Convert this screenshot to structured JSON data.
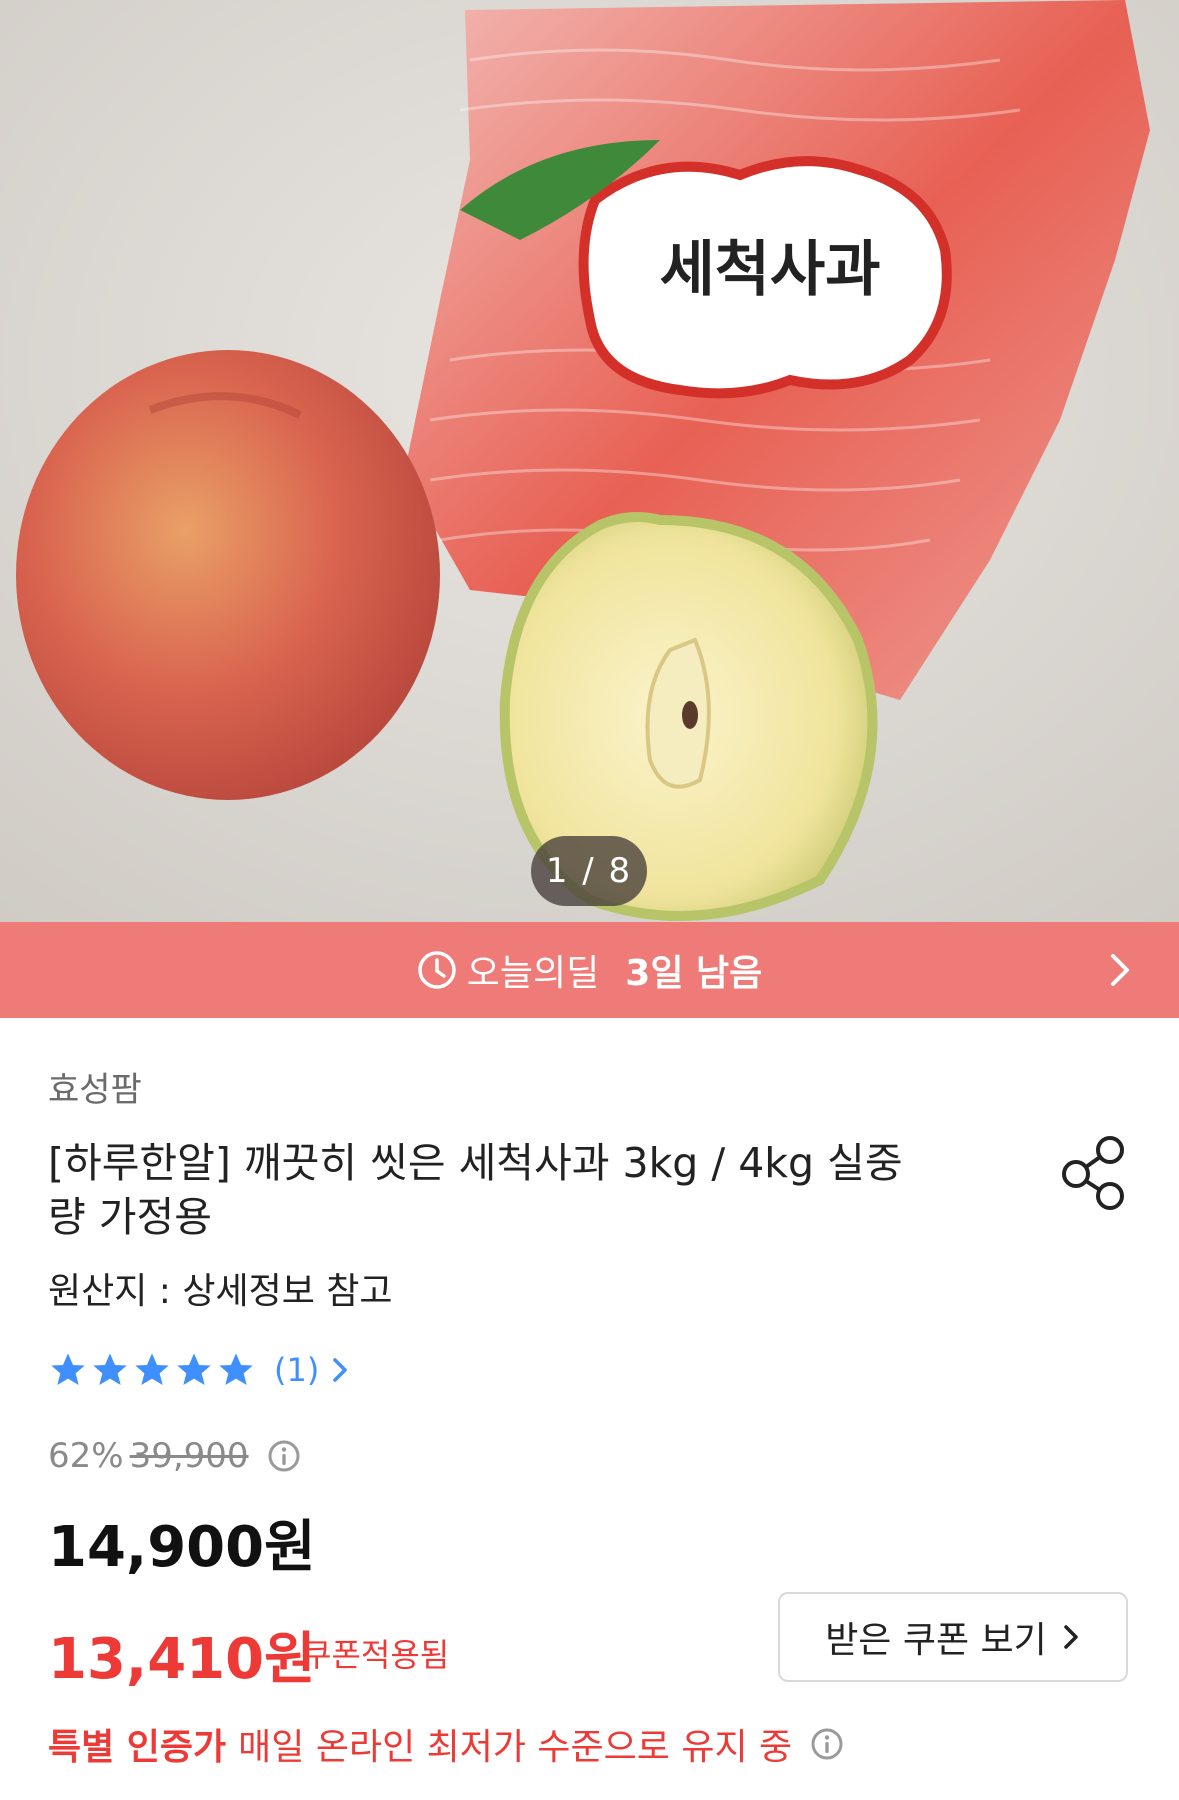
{
  "gallery": {
    "package_text": "세척사과",
    "counter": "1 / 8"
  },
  "deal": {
    "label": "오늘의딜",
    "remaining": "3일 남음",
    "icon": "clock-icon",
    "accent_color": "#ee7b77"
  },
  "product": {
    "seller": "효성팜",
    "title": "[하루한알] 깨끗히 씻은 세척사과 3kg / 4kg 실중량 가정용",
    "origin": "원산지 : 상세정보 참고",
    "rating": {
      "stars": 5,
      "max": 5,
      "review_count": "(1)"
    },
    "discount_rate": "62%",
    "original_price": "39,900",
    "price": "14,900원",
    "coupon_price": "13,410원",
    "coupon_applied_label": "쿠폰적용됨",
    "coupon_button": "받은 쿠폰 보기",
    "special_strong": "특별 인증가",
    "special_text": "매일 온라인 최저가 수준으로 유지 중"
  },
  "colors": {
    "star": "#3f8fff",
    "sale_red": "#ee3a37"
  }
}
